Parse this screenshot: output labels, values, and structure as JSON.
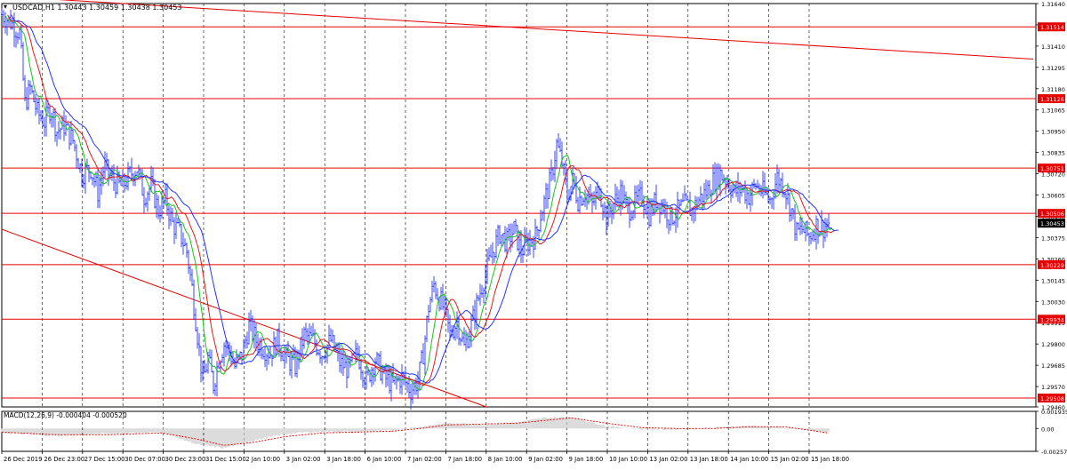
{
  "window": {
    "symbol_line": "USDCAD,H1 1.30443 1.30459 1.30438 1.30453",
    "menu_glyph": "▾"
  },
  "colors": {
    "background": "#ffffff",
    "grid": "#000000",
    "candles": "#2433ff",
    "ma_fast": "#18c418",
    "ma_mid": "#e11a1a",
    "ma_slow": "#2433ff",
    "levels": "#e60000",
    "trendline": "#e60000",
    "price_tag_bg": "#e60000",
    "current_tag_bg": "#000000",
    "macd_hist": "#b8b8b8",
    "macd_signal": "#e60000"
  },
  "chart_data": [
    {
      "type": "candlestick",
      "title": "USDCAD,H1",
      "ohlc_readout": {
        "open": 1.30443,
        "high": 1.30459,
        "low": 1.30438,
        "close": 1.30453
      },
      "ylim": [
        1.2946,
        1.3164
      ],
      "y_ticks": [
        "1.31640",
        "1.31525",
        "1.31410",
        "1.31295",
        "1.31180",
        "1.31065",
        "1.30950",
        "1.30835",
        "1.30720",
        "1.30605",
        "1.30490",
        "1.30375",
        "1.30260",
        "1.30145",
        "1.30030",
        "1.29915",
        "1.29800",
        "1.29685",
        "1.29570",
        "1.29460"
      ],
      "x_tick_labels": [
        "26 Dec 2019",
        "26 Dec 23:00",
        "27 Dec 15:00",
        "30 Dec 07:00",
        "30 Dec 23:00",
        "31 Dec 15:00",
        "2 Jan 10:00",
        "3 Jan 02:00",
        "3 Jan 18:00",
        "6 Jan 10:00",
        "7 Jan 02:00",
        "7 Jan 18:00",
        "8 Jan 10:00",
        "9 Jan 02:00",
        "9 Jan 18:00",
        "10 Jan 10:00",
        "13 Jan 02:00",
        "13 Jan 18:00",
        "14 Jan 10:00",
        "15 Jan 02:00",
        "15 Jan 18:00"
      ],
      "horizontal_levels": [
        1.31514,
        1.31126,
        1.30751,
        1.30506,
        1.30229,
        1.29934,
        1.29508
      ],
      "horizontal_level_labels": [
        "1.31514",
        "1.31126",
        "1.30751",
        "1.30506",
        "1.30229",
        "1.29934",
        "1.29508"
      ],
      "current_price_label": "1.30453",
      "price_path": [
        [
          0,
          1.3158
        ],
        [
          10,
          1.3154
        ],
        [
          20,
          1.3148
        ],
        [
          26,
          1.311
        ],
        [
          32,
          1.3118
        ],
        [
          40,
          1.3105
        ],
        [
          48,
          1.31
        ],
        [
          55,
          1.3108
        ],
        [
          62,
          1.3095
        ],
        [
          70,
          1.3098
        ],
        [
          80,
          1.309
        ],
        [
          90,
          1.3072
        ],
        [
          100,
          1.3075
        ],
        [
          108,
          1.3062
        ],
        [
          115,
          1.3076
        ],
        [
          125,
          1.3068
        ],
        [
          135,
          1.3065
        ],
        [
          145,
          1.3072
        ],
        [
          152,
          1.3075
        ],
        [
          160,
          1.306
        ],
        [
          168,
          1.3066
        ],
        [
          176,
          1.3052
        ],
        [
          184,
          1.3058
        ],
        [
          192,
          1.3045
        ],
        [
          200,
          1.304
        ],
        [
          208,
          1.303
        ],
        [
          214,
          1.301
        ],
        [
          220,
          1.2985
        ],
        [
          226,
          1.296
        ],
        [
          232,
          1.2972
        ],
        [
          238,
          1.2958
        ],
        [
          244,
          1.2972
        ],
        [
          250,
          1.298
        ],
        [
          256,
          1.2976
        ],
        [
          262,
          1.2968
        ],
        [
          270,
          1.2974
        ],
        [
          278,
          1.299
        ],
        [
          286,
          1.2982
        ],
        [
          294,
          1.2978
        ],
        [
          302,
          1.2975
        ],
        [
          310,
          1.2982
        ],
        [
          320,
          1.2972
        ],
        [
          330,
          1.2968
        ],
        [
          340,
          1.2985
        ],
        [
          350,
          1.2982
        ],
        [
          360,
          1.2975
        ],
        [
          370,
          1.2982
        ],
        [
          380,
          1.297
        ],
        [
          390,
          1.2966
        ],
        [
          400,
          1.2975
        ],
        [
          410,
          1.296
        ],
        [
          420,
          1.2972
        ],
        [
          430,
          1.2962
        ],
        [
          440,
          1.2958
        ],
        [
          450,
          1.2962
        ],
        [
          460,
          1.2955
        ],
        [
          468,
          1.296
        ],
        [
          474,
          1.2975
        ],
        [
          480,
          1.3
        ],
        [
          486,
          1.3012
        ],
        [
          492,
          1.3005
        ],
        [
          498,
          1.2998
        ],
        [
          504,
          1.2985
        ],
        [
          512,
          1.2992
        ],
        [
          520,
          1.2978
        ],
        [
          528,
          1.299
        ],
        [
          536,
          1.3005
        ],
        [
          544,
          1.3018
        ],
        [
          552,
          1.303
        ],
        [
          560,
          1.304
        ],
        [
          568,
          1.3035
        ],
        [
          576,
          1.3042
        ],
        [
          584,
          1.303
        ],
        [
          592,
          1.3035
        ],
        [
          600,
          1.3038
        ],
        [
          606,
          1.305
        ],
        [
          612,
          1.306
        ],
        [
          618,
          1.307
        ],
        [
          624,
          1.3088
        ],
        [
          630,
          1.3078
        ],
        [
          636,
          1.306
        ],
        [
          642,
          1.3068
        ],
        [
          648,
          1.3058
        ],
        [
          656,
          1.3062
        ],
        [
          664,
          1.3055
        ],
        [
          672,
          1.3064
        ],
        [
          680,
          1.3048
        ],
        [
          688,
          1.3056
        ],
        [
          696,
          1.3062
        ],
        [
          704,
          1.3052
        ],
        [
          712,
          1.3056
        ],
        [
          720,
          1.306
        ],
        [
          728,
          1.305
        ],
        [
          736,
          1.3058
        ],
        [
          744,
          1.3055
        ],
        [
          752,
          1.3048
        ],
        [
          760,
          1.3052
        ],
        [
          768,
          1.3055
        ],
        [
          776,
          1.3052
        ],
        [
          784,
          1.3058
        ],
        [
          792,
          1.3062
        ],
        [
          800,
          1.3068
        ],
        [
          808,
          1.3072
        ],
        [
          816,
          1.3068
        ],
        [
          824,
          1.3062
        ],
        [
          832,
          1.3064
        ],
        [
          840,
          1.306
        ],
        [
          848,
          1.3066
        ],
        [
          856,
          1.3062
        ],
        [
          864,
          1.3058
        ],
        [
          872,
          1.307
        ],
        [
          880,
          1.3065
        ],
        [
          888,
          1.3052
        ],
        [
          894,
          1.304
        ],
        [
          900,
          1.3042
        ],
        [
          908,
          1.3038
        ],
        [
          916,
          1.3044
        ],
        [
          924,
          1.3043
        ],
        [
          930,
          1.30453
        ]
      ],
      "trendlines": [
        {
          "from": [
            0,
            1.3168
          ],
          "to": [
            1160,
            1.3134
          ]
        },
        {
          "from": [
            0,
            1.3042
          ],
          "to": [
            545,
            1.2946
          ]
        }
      ]
    },
    {
      "type": "histogram",
      "title": "MACD(12,26,9) -0.000404 -0.000520",
      "ylim": [
        -0.00257,
        0.00193
      ],
      "y_ticks": [
        "0.001935",
        "0.00",
        "-0.00257"
      ],
      "hist": [
        [
          0,
          -0.0005
        ],
        [
          60,
          -0.0008
        ],
        [
          120,
          -0.0006
        ],
        [
          180,
          -0.0004
        ],
        [
          220,
          -0.0018
        ],
        [
          250,
          -0.0022
        ],
        [
          280,
          -0.0014
        ],
        [
          320,
          -0.0006
        ],
        [
          360,
          -0.0003
        ],
        [
          400,
          -0.0004
        ],
        [
          440,
          -0.0002
        ],
        [
          470,
          0.0002
        ],
        [
          500,
          0.0006
        ],
        [
          540,
          0.0004
        ],
        [
          580,
          0.0007
        ],
        [
          610,
          0.0012
        ],
        [
          640,
          0.0013
        ],
        [
          680,
          0.0003
        ],
        [
          720,
          -0.0001
        ],
        [
          760,
          -0.0001
        ],
        [
          800,
          0.0001
        ],
        [
          840,
          0.0003
        ],
        [
          880,
          0.0001
        ],
        [
          910,
          -0.0003
        ],
        [
          930,
          -0.0004
        ]
      ],
      "signal": [
        [
          0,
          -0.0004
        ],
        [
          60,
          -0.0007
        ],
        [
          120,
          -0.0007
        ],
        [
          180,
          -0.0005
        ],
        [
          220,
          -0.0012
        ],
        [
          250,
          -0.0019
        ],
        [
          280,
          -0.0016
        ],
        [
          320,
          -0.0009
        ],
        [
          360,
          -0.0005
        ],
        [
          400,
          -0.0004
        ],
        [
          440,
          -0.0003
        ],
        [
          470,
          0.0
        ],
        [
          500,
          0.0004
        ],
        [
          540,
          0.0005
        ],
        [
          580,
          0.0006
        ],
        [
          610,
          0.0009
        ],
        [
          640,
          0.0012
        ],
        [
          680,
          0.0006
        ],
        [
          720,
          0.0001
        ],
        [
          760,
          0.0
        ],
        [
          800,
          0.0
        ],
        [
          840,
          0.0002
        ],
        [
          880,
          0.0002
        ],
        [
          910,
          -0.0002
        ],
        [
          930,
          -0.00052
        ]
      ]
    }
  ]
}
